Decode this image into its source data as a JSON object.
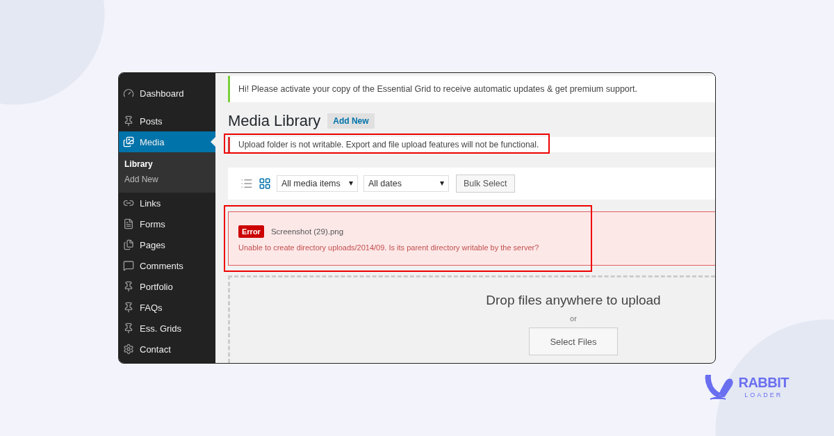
{
  "sidebar": {
    "items": [
      {
        "label": "Dashboard",
        "selected": false
      },
      {
        "label": "Posts",
        "selected": false
      },
      {
        "label": "Media",
        "selected": true,
        "children": [
          {
            "label": "Library",
            "selected": true
          },
          {
            "label": "Add New",
            "selected": false
          }
        ]
      },
      {
        "label": "Links",
        "selected": false
      },
      {
        "label": "Forms",
        "selected": false
      },
      {
        "label": "Pages",
        "selected": false
      },
      {
        "label": "Comments",
        "selected": false
      },
      {
        "label": "Portfolio",
        "selected": false
      },
      {
        "label": "FAQs",
        "selected": false
      },
      {
        "label": "Ess. Grids",
        "selected": false
      },
      {
        "label": "Contact",
        "selected": false
      }
    ]
  },
  "activation_notice": {
    "text": "Hi! Please activate your copy of the Essential Grid to receive automatic updates & get premium support.",
    "highlighted": false
  },
  "page_title": "Media Library",
  "add_new_button": "Add New",
  "upload_notice": {
    "text": "Upload folder is not writable. Export and file upload features will not be functional.",
    "highlighted": true
  },
  "toolbar": {
    "views": [
      {
        "kind": "list",
        "selected": false
      },
      {
        "kind": "grid",
        "selected": true
      }
    ],
    "filters": [
      {
        "value": "All media items"
      },
      {
        "value": "All dates"
      }
    ],
    "bulk_button": "Bulk Select"
  },
  "upload_error": {
    "badge": "Error",
    "file": "Screenshot (29).png",
    "message": "Unable to create directory uploads/2014/09. Is its parent directory writable by the server?",
    "highlighted": true
  },
  "dropzone": {
    "title": "Drop files anywhere to upload",
    "or": "or",
    "button": "Select Files"
  },
  "logo": {
    "name": "RABBIT",
    "tagline": "LOADER"
  }
}
